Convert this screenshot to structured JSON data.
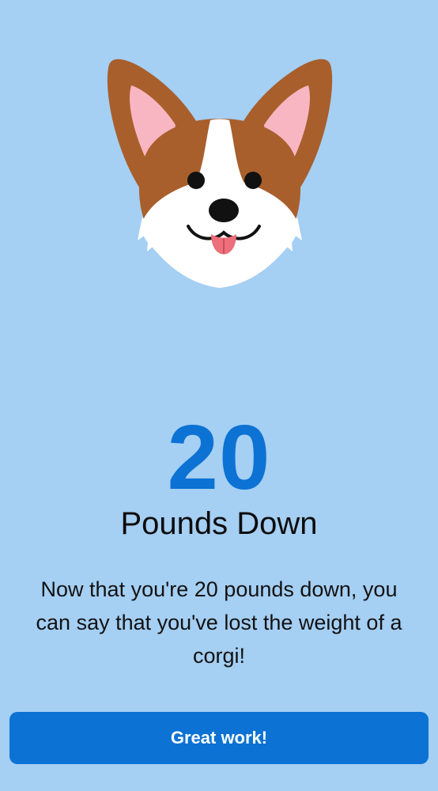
{
  "illustration": {
    "icon": "corgi-face-icon",
    "colors": {
      "fur": "#a85f2c",
      "inner_ear": "#f7b6c1",
      "face": "#ffffff",
      "eyes": "#111111",
      "tongue": "#ec6f7b"
    }
  },
  "milestone": {
    "value": "20",
    "unit": "Pounds Down",
    "message": "Now that you're 20 pounds down, you can say that you've lost the weight of a corgi!"
  },
  "actions": {
    "primary_label": "Great work!"
  },
  "colors": {
    "background": "#a5cff3",
    "accent": "#0c72d4",
    "text": "#121212"
  }
}
